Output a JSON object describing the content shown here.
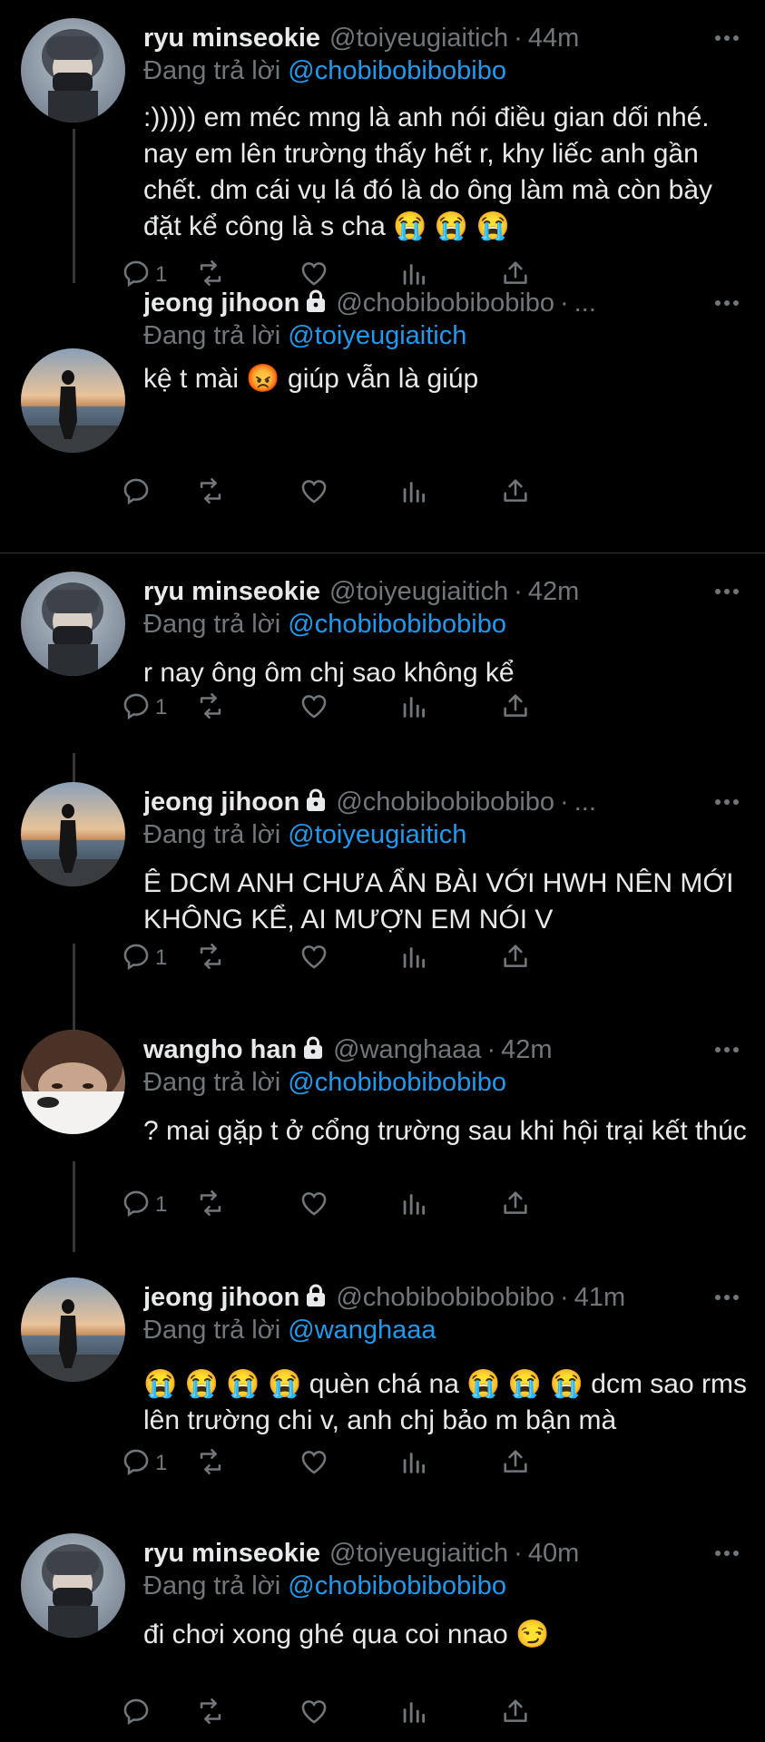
{
  "colors": {
    "background": "#000000",
    "text": "#e7e9ea",
    "muted": "#71767b",
    "link": "#1d9bf0",
    "divider": "#2f3336"
  },
  "reply_prefix": "Đang trả lời",
  "tweets": [
    {
      "name": "ryu minseokie",
      "locked": false,
      "handle": "@toiyeugiaitich",
      "sep": "·",
      "time": "44m",
      "reply_to": "@chobibobibobibo",
      "text": ":))))) em méc mng là anh nói điều gian dối nhé. nay em lên trường thấy hết r, khy liếc anh gần chết. dm cái vụ lá đó là do ông làm mà còn bày đặt kể công là s cha 😭 😭 😭",
      "reply_count": "1",
      "avatar": "ryu"
    },
    {
      "name": "jeong jihoon",
      "locked": true,
      "handle": "@chobibobibobibo",
      "sep": "·",
      "time": "...",
      "reply_to": "@toiyeugiaitich",
      "text": "kệ t mài 😡  giúp vẫn là giúp",
      "reply_count": "",
      "avatar": "jihoon"
    },
    {
      "name": "ryu minseokie",
      "locked": false,
      "handle": "@toiyeugiaitich",
      "sep": "·",
      "time": "42m",
      "reply_to": "@chobibobibobibo",
      "text": "r nay ông ôm chj sao không kể",
      "reply_count": "1",
      "avatar": "ryu"
    },
    {
      "name": "jeong jihoon",
      "locked": true,
      "handle": "@chobibobibobibo",
      "sep": "·",
      "time": "...",
      "reply_to": "@toiyeugiaitich",
      "text": "Ê DCM ANH CHƯA ẨN BÀI VỚI HWH NÊN MỚI KHÔNG KỂ, AI MƯỢN EM NÓI V",
      "reply_count": "1",
      "avatar": "jihoon"
    },
    {
      "name": "wangho han",
      "locked": true,
      "handle": "@wanghaaa",
      "sep": "·",
      "time": "42m",
      "reply_to": "@chobibobibobibo",
      "text": "? mai gặp t ở cổng trường sau khi hội trại kết thúc",
      "reply_count": "1",
      "avatar": "wangho"
    },
    {
      "name": "jeong jihoon",
      "locked": true,
      "handle": "@chobibobibobibo",
      "sep": "·",
      "time": "41m",
      "reply_to": "@wanghaaa",
      "text": "😭 😭 😭 😭  quèn chá na 😭 😭 😭  dcm sao rms lên trường chi v, anh chj bảo m bận mà",
      "reply_count": "1",
      "avatar": "jihoon"
    },
    {
      "name": "ryu minseokie",
      "locked": false,
      "handle": "@toiyeugiaitich",
      "sep": "·",
      "time": "40m",
      "reply_to": "@chobibobibobibo",
      "text": "đi chơi xong ghé qua coi nnao 😏",
      "reply_count": "",
      "avatar": "ryu"
    }
  ],
  "icons": [
    "reply-icon",
    "retweet-icon",
    "like-icon",
    "analytics-icon",
    "share-icon",
    "more-icon",
    "lock-icon"
  ]
}
